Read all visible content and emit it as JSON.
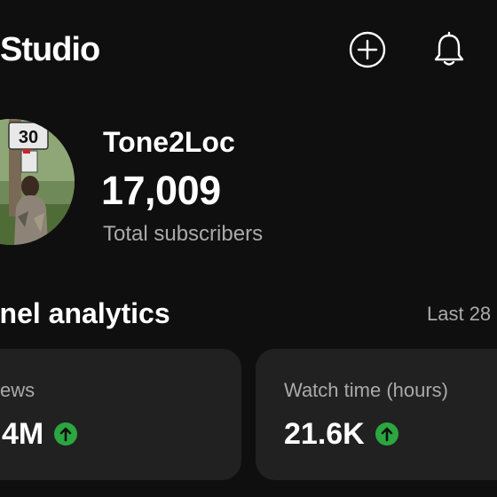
{
  "header": {
    "title": "Studio",
    "add_icon": "add-circle-icon",
    "notifications_icon": "bell-icon"
  },
  "channel": {
    "name": "Tone2Loc",
    "subscriber_count": "17,009",
    "subscriber_label": "Total subscribers"
  },
  "analytics": {
    "title": "nnel analytics",
    "period": "Last 28",
    "cards": [
      {
        "label": "ews",
        "value": "4M",
        "trend": "up"
      },
      {
        "label": "Watch time (hours)",
        "value": "21.6K",
        "trend": "up"
      }
    ]
  },
  "colors": {
    "background": "#0f0f0f",
    "card": "#212121",
    "text_primary": "#ffffff",
    "text_secondary": "#aaaaaa",
    "trend_up": "#2ba640"
  }
}
